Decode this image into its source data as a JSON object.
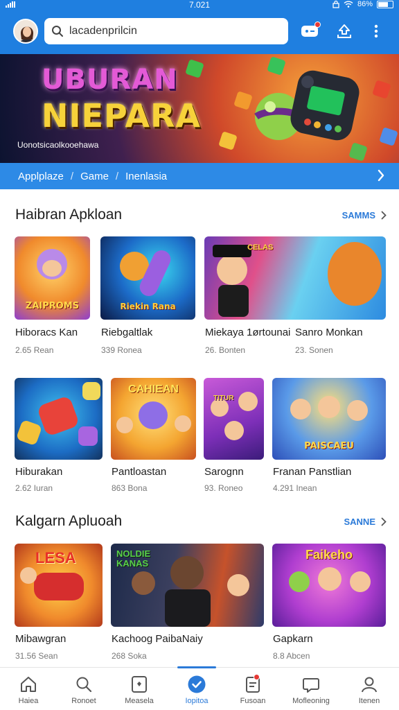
{
  "status_bar": {
    "time": "7.021",
    "battery": "86%"
  },
  "header": {
    "search_value": "lacadenprilcin"
  },
  "hero": {
    "title_line1": "UBURAN",
    "title_line2": "NIEPARA",
    "subtitle": "Uonotsicaolkooehawa"
  },
  "breadcrumb": {
    "items": [
      "Applplaze",
      "Game",
      "Inenlasia"
    ]
  },
  "sections": [
    {
      "title": "Haibran Apkloan",
      "more_label": "SAMMS",
      "rows": [
        [
          {
            "name": "Hiboracs Kan",
            "meta": "2.65 Rean",
            "art_text": "ZAIPROMS"
          },
          {
            "name": "Riebgaltlak",
            "meta": "339 Ronea",
            "art_text": "Riekin Rana"
          },
          {
            "name": "Miekaya 1ørtounai",
            "meta": "26. Bonten",
            "art_text": "CELAS"
          },
          {
            "name": "Sanro Monkan",
            "meta": "23. Sonen",
            "art_text": ""
          }
        ],
        [
          {
            "name": "Hiburakan",
            "meta": "2.62 Iuran",
            "art_text": ""
          },
          {
            "name": "Pantloastan",
            "meta": "863 Bona",
            "art_text": "CAHIEAN"
          },
          {
            "name": "Sarognn",
            "meta": "93. Roneo",
            "art_text": "TITUR"
          },
          {
            "name": "Franan Panstlian",
            "meta": "4.291 Inean",
            "art_text": "PAISCAEU"
          }
        ]
      ]
    },
    {
      "title": "Kalgarn Apluoah",
      "more_label": "SANNE",
      "rows": [
        [
          {
            "name": "Mibawgran",
            "meta": "31.56 Sean",
            "art_text": "LESA"
          },
          {
            "name": "Kachoog PaibaNaiy",
            "meta": "268 Soka",
            "art_text": "NOLDIE KANAS"
          },
          {
            "name": "Gapkarn",
            "meta": "8.8 Abcen",
            "art_text": "Faikeho"
          }
        ]
      ]
    }
  ],
  "bottom_nav": [
    {
      "label": "Haiea",
      "icon": "home-icon"
    },
    {
      "label": "Ronoet",
      "icon": "search-icon"
    },
    {
      "label": "Measela",
      "icon": "app-box-icon"
    },
    {
      "label": "Iopitoa",
      "icon": "checkmark-badge-icon",
      "active": true
    },
    {
      "label": "Fusoan",
      "icon": "clipboard-icon"
    },
    {
      "label": "Mofleoning",
      "icon": "chat-bubble-icon"
    },
    {
      "label": "Itenen",
      "icon": "person-icon"
    }
  ],
  "colors": {
    "primary": "#1f7fe0",
    "breadcrumb_bar": "#2d8ae6",
    "link": "#2b7ad8",
    "badge": "#e53935"
  }
}
